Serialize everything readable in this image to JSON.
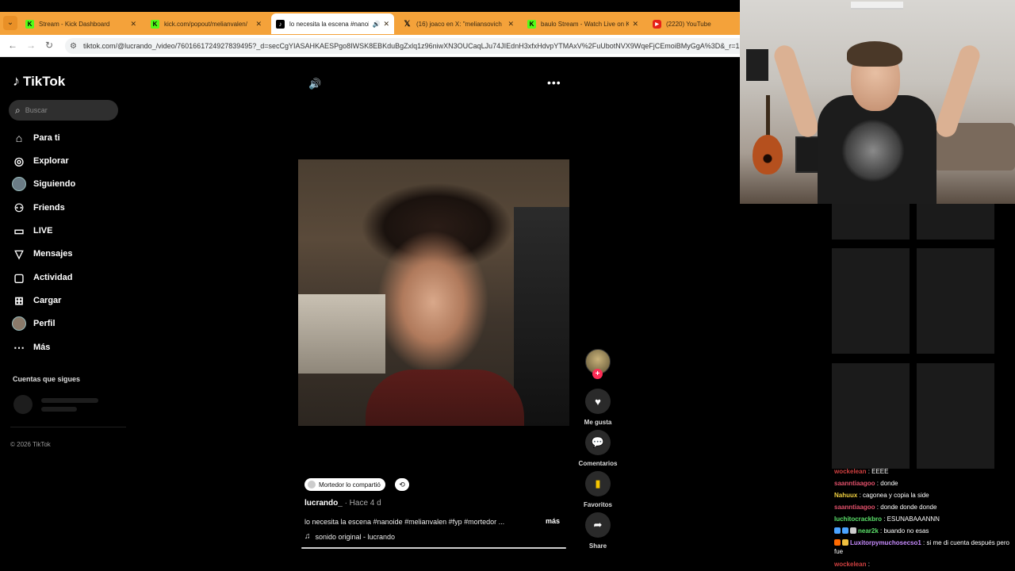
{
  "browser": {
    "tabs": [
      {
        "icon": "kick-favicon",
        "title": "Stream - Kick Dashboard",
        "active": false
      },
      {
        "icon": "kick-favicon",
        "title": "kick.com/popout/melianvalen/",
        "active": false
      },
      {
        "icon": "tiktok-favicon",
        "title": "lo necesita la escena #nanoi",
        "active": true
      },
      {
        "icon": "x-favicon",
        "title": "(16) joaco en X: \"meliansovich",
        "active": false
      },
      {
        "icon": "kick-favicon",
        "title": "baulo Stream - Watch Live on K",
        "active": false
      },
      {
        "icon": "youtube-favicon",
        "title": "(2220) YouTube",
        "active": false
      }
    ],
    "url": "tiktok.com/@lucrando_/video/7601661724927839495?_d=secCgYIASAHKAESPgo8IWSK8EBKduBgZxlq1z96niwXN3OUCaqLJu74JIEdnH3xfxHdvpYTMAxV%2FuUbotNVX9WqeFjCEmoiBMyGgA%3D&_r=1"
  },
  "sidebar": {
    "logo": "TikTok",
    "search_placeholder": "Buscar",
    "nav": [
      {
        "icon": "home-icon",
        "label": "Para ti"
      },
      {
        "icon": "compass-icon",
        "label": "Explorar"
      },
      {
        "icon": "following-avatar-icon",
        "label": "Siguiendo"
      },
      {
        "icon": "friends-icon",
        "label": "Friends"
      },
      {
        "icon": "live-icon",
        "label": "LIVE"
      },
      {
        "icon": "send-icon",
        "label": "Mensajes"
      },
      {
        "icon": "activity-icon",
        "label": "Actividad"
      },
      {
        "icon": "upload-icon",
        "label": "Cargar"
      },
      {
        "icon": "profile-avatar-icon",
        "label": "Perfil"
      },
      {
        "icon": "more-icon",
        "label": "Más"
      }
    ],
    "following_title": "Cuentas que sigues",
    "copyright": "© 2026 TikTok"
  },
  "video": {
    "actions": [
      {
        "icon": "heart-icon",
        "label": "Me gusta"
      },
      {
        "icon": "comment-icon",
        "label": "Comentarios"
      },
      {
        "icon": "bookmark-icon",
        "label": "Favoritos"
      },
      {
        "icon": "share-icon",
        "label": "Share"
      }
    ],
    "repost_label": "Mortedor lo compartió",
    "author": "lucrando_",
    "time": "· Hace 4 d",
    "description": "lo necesita la escena #nanoide #melianvalen #fyp #mortedor ...",
    "more_label": "más",
    "sound": "sonido original - lucrando",
    "progress": 1.0
  },
  "chat": [
    {
      "user": "wockelean",
      "color": "#d04040",
      "message": ": EEEE",
      "badges": []
    },
    {
      "user": "saanntiaagoo",
      "color": "#e0506a",
      "message": ": donde",
      "badges": []
    },
    {
      "user": "Nahuux",
      "color": "#f0d040",
      "message": ": cagonea y copia la side",
      "badges": []
    },
    {
      "user": "saanntiaagoo",
      "color": "#e0506a",
      "message": ": donde donde donde",
      "badges": []
    },
    {
      "user": "luchitocrackbro",
      "color": "#5be06a",
      "message": ": ESUNABAAANNN",
      "badges": []
    },
    {
      "user": "near2k",
      "color": "#5be06a",
      "message": ": buando no esas",
      "badges": [
        "#4aa3ff",
        "#4aa3ff",
        "#cccccc"
      ]
    },
    {
      "user": "Luxitorpymuchosecso1",
      "color": "#c88cff",
      "message": ": si me di cuenta después pero fue",
      "badges": [
        "#ff6a00",
        "#f0c040"
      ]
    },
    {
      "user": "wockelean",
      "color": "#d04040",
      "message": ":",
      "badges": []
    }
  ]
}
